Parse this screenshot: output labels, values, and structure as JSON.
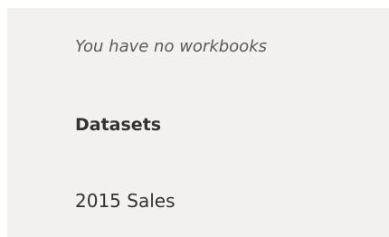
{
  "workbooks": {
    "empty_message": "You have no workbooks"
  },
  "datasets": {
    "heading": "Datasets",
    "items": [
      {
        "label": "2015 Sales"
      }
    ]
  },
  "colors": {
    "panel_background": "#f2f1f0",
    "text_primary": "#333333",
    "text_muted": "#5a5a5a"
  }
}
